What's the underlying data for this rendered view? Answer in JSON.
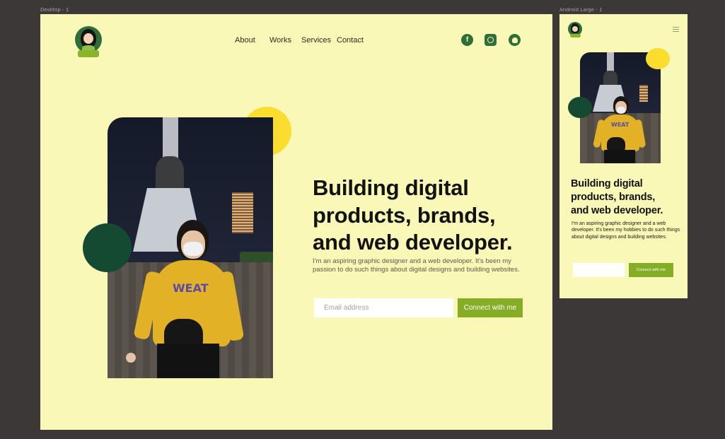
{
  "frames": {
    "desktop_label": "Desktop - 1",
    "android_label": "Android Large - 1"
  },
  "colors": {
    "canvas_bg": "#3d3838",
    "page_bg": "#f9f8b7",
    "accent_green": "#85ad25",
    "dark_green": "#154a32",
    "yellow": "#fbdd30"
  },
  "nav": {
    "about": "About",
    "works": "Works",
    "services": "Services",
    "contact": "Contact"
  },
  "social": {
    "facebook_icon": "facebook-icon",
    "instagram_icon": "instagram-icon",
    "github_icon": "github-icon"
  },
  "hero": {
    "headline_line1": "Building digital",
    "headline_line2": "products, brands,",
    "headline_line3": "and web developer.",
    "description": "I'm an aspiring graphic designer and a web developer. It's been my passion to do such things about digital designs and building websites.",
    "email_placeholder": "Email address",
    "cta_label": "Connect with me",
    "photo_shirt_text": "WEAT"
  },
  "mobile": {
    "headline_line1": "Building digital",
    "headline_line2": "products, brands,",
    "headline_line3": "and web developer.",
    "description": "I'm an aspiring graphic designer and a web developer. It's been my hobbies to do such things about digital designs and building websites.",
    "email_placeholder": "",
    "cta_label": "Connect with me",
    "menu_icon": "hamburger-menu-icon"
  }
}
